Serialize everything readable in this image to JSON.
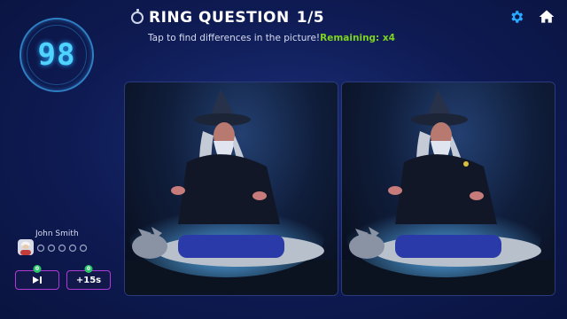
{
  "timer": {
    "value": "98"
  },
  "question": {
    "title": "RING QUESTION",
    "count": "1/5"
  },
  "instruction": {
    "text": "Tap to find differences in the picture!",
    "remaining": "Remaining: x4"
  },
  "icons": {
    "settings": "gear-icon",
    "home": "home-icon",
    "ring": "ring-icon"
  },
  "player": {
    "name": "John Smith",
    "hint_slots": 5
  },
  "powerups": {
    "skip": {
      "label": "▶▏",
      "count": "0"
    },
    "time": {
      "label": "+15s",
      "count": "0"
    }
  },
  "colors": {
    "accent": "#4fd3ff",
    "remaining": "#7ed321",
    "powerup_border": "#b03ad6",
    "badge": "#29c46a"
  }
}
